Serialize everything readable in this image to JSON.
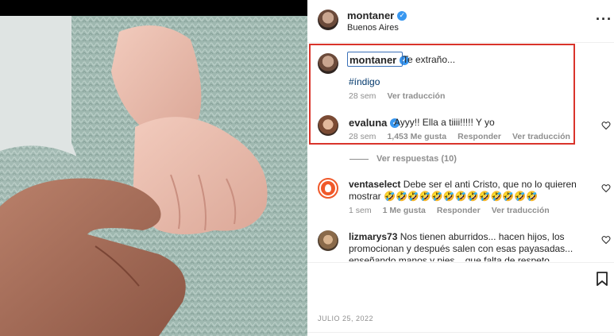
{
  "post": {
    "username": "montaner",
    "location": "Buenos Aires"
  },
  "caption": {
    "username": "montaner",
    "text": "Te extraño...",
    "hashtag": "#índigo",
    "time": "28 sem",
    "translate": "Ver traducción"
  },
  "comments": [
    {
      "username": "evaluna",
      "verified": true,
      "text": "Ayyy!! Ella a tiiii!!!!! Y yo",
      "time": "28 sem",
      "likes": "1,453 Me gusta",
      "reply": "Responder",
      "translate": "Ver traducción"
    },
    {
      "username": "ventaselect",
      "verified": false,
      "text_line1": "Debe ser el anti Cristo, que no lo quieren",
      "text_line2": "mostrar 🤣🤣🤣🤣🤣🤣🤣🤣🤣🤣🤣🤣🤣",
      "time": "1 sem",
      "likes": "1 Me gusta",
      "reply": "Responder",
      "translate": "Ver traducción"
    },
    {
      "username": "lizmarys73",
      "verified": false,
      "text_line1": "Nos tienen aburridos... hacen hijos, los",
      "text_line2": "promocionan y después salen con esas payasadas...",
      "text_line3": "enseñando manos y pies... que falta de respeto"
    }
  ],
  "view_replies": "Ver respuestas (10)",
  "date": "JULIO 25, 2022",
  "colors": {
    "highlight_box": "#d9342b",
    "verified": "#3897f0",
    "hashtag": "#00376b",
    "meta": "#8e8e8e"
  },
  "icons": {
    "more": "more-options-icon",
    "heart": "heart-outline-icon",
    "bookmark": "bookmark-outline-icon",
    "verified": "verified-badge-icon"
  }
}
